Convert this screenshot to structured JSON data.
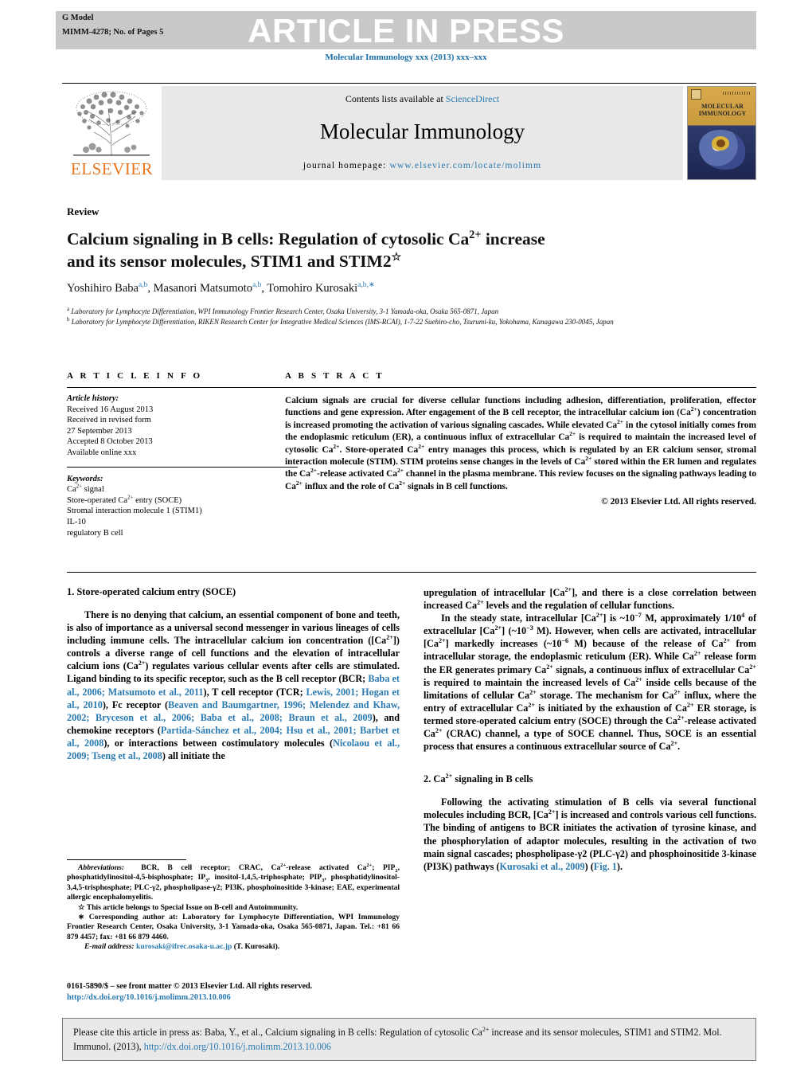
{
  "header": {
    "g_model": "G Model",
    "model_id": "MIMM-4278;   No. of Pages 5",
    "banner": "ARTICLE IN PRESS",
    "journal_ref": "Molecular Immunology xxx (2013) xxx–xxx"
  },
  "masthead": {
    "contents_prefix": "Contents lists available at ",
    "sciencedirect": "ScienceDirect",
    "journal_title": "Molecular Immunology",
    "homepage_label": "journal homepage: ",
    "homepage_url": "www.elsevier.com/locate/molimm",
    "publisher": "ELSEVIER",
    "cover_title_line1": "MOLECULAR",
    "cover_title_line2": "IMMUNOLOGY"
  },
  "article": {
    "type_label": "Review",
    "title_line1": "Calcium signaling in B cells: Regulation of cytosolic Ca",
    "title_sup1": "2+",
    "title_line1b": " increase",
    "title_line2": "and its sensor molecules, STIM1 and STIM2",
    "title_star": "☆",
    "authors_1": "Yoshihiro Baba",
    "authors_1_sup": "a,b",
    "authors_2": ", Masanori Matsumoto",
    "authors_2_sup": "a,b",
    "authors_3": ", Tomohiro Kurosaki",
    "authors_3_sup": "a,b,∗",
    "affil_a_sup": "a",
    "affil_a": " Laboratory for Lymphocyte Differentiation, WPI Immunology Frontier Research Center, Osaka University, 3-1 Yamada-oka, Osaka 565-0871, Japan",
    "affil_b_sup": "b",
    "affil_b": " Laboratory for Lymphocyte Differentiation, RIKEN Research Center for Integrative Medical Sciences (IMS-RCAI), 1-7-22 Suehiro-cho, Tsurumi-ku, Yokohama, Kanagawa 230-0045, Japan"
  },
  "info": {
    "heading": "A R T I C L E    I N F O",
    "history_label": "Article history:",
    "history": [
      "Received 16 August 2013",
      "Received in revised form",
      "27 September 2013",
      "Accepted 8 October 2013",
      "Available online xxx"
    ],
    "keywords_label": "Keywords:",
    "keywords": [
      "Ca2+ signal",
      "Store-operated Ca2+ entry (SOCE)",
      "Stromal interaction molecule 1 (STIM1)",
      "IL-10",
      "regulatory B cell"
    ]
  },
  "abstract": {
    "heading": "A B S T R A C T",
    "text": "Calcium signals are crucial for diverse cellular functions including adhesion, differentiation, proliferation, effector functions and gene expression. After engagement of the B cell receptor, the intracellular calcium ion (Ca2+) concentration is increased promoting the activation of various signaling cascades. While elevated Ca2+ in the cytosol initially comes from the endoplasmic reticulum (ER), a continuous influx of extracellular Ca2+ is required to maintain the increased level of cytosolic Ca2+. Store-operated Ca2+ entry manages this process, which is regulated by an ER calcium sensor, stromal interaction molecule (STIM). STIM proteins sense changes in the levels of Ca2+ stored within the ER lumen and regulates the Ca2+-release activated Ca2+ channel in the plasma membrane. This review focuses on the signaling pathways leading to Ca2+ influx and the role of Ca2+ signals in B cell functions.",
    "copyright": "© 2013 Elsevier Ltd. All rights reserved."
  },
  "body": {
    "section1_heading": "1.  Store-operated calcium entry (SOCE)",
    "section1_p1": "There is no denying that calcium, an essential component of bone and teeth, is also of importance as a universal second messenger in various lineages of cells including immune cells. The intracellular calcium ion concentration ([Ca2+]) controls a diverse range of cell functions and the elevation of intracellular calcium ions (Ca2+) regulates various cellular events after cells are stimulated. Ligand binding to its specific receptor, such as the B cell receptor (BCR; ",
    "cit1": "Baba et al., 2006; Matsumoto et al., 2011",
    "section1_p1b": "), T cell receptor (TCR; ",
    "cit2": "Lewis, 2001; Hogan et al., 2010",
    "section1_p1c": "), Fc receptor (",
    "cit3": "Beaven and Baumgartner, 1996; Melendez and Khaw, 2002; Bryceson et al., 2006; Baba et al., 2008; Braun et al., 2009",
    "section1_p1d": "), and chemokine receptors (",
    "cit4": "Partida-Sánchez et al., 2004; Hsu et al., 2001; Barbet et al., 2008",
    "section1_p1e": "), or interactions between costimulatory molecules (",
    "cit5": "Nicolaou et al., 2009; Tseng et al., 2008",
    "section1_p1f": ") all initiate the",
    "right_p1": "upregulation of intracellular [Ca2+], and there is a close correlation between increased Ca2+ levels and the regulation of cellular functions.",
    "right_p2": "In the steady state, intracellular [Ca2+] is ~10−7 M, approximately 1/104 of extracellular [Ca2+] (~10−3 M). However, when cells are activated, intracellular [Ca2+] markedly increases (~10−6 M) because of the release of Ca2+ from intracellular storage, the endoplasmic reticulum (ER). While Ca2+ release form the ER generates primary Ca2+ signals, a continuous influx of extracellular Ca2+ is required to maintain the increased levels of Ca2+ inside cells because of the limitations of cellular Ca2+ storage. The mechanism for Ca2+ influx, where the entry of extracellular Ca2+ is initiated by the exhaustion of Ca2+ ER storage, is termed store-operated calcium entry (SOCE) through the Ca2+-release activated Ca2+ (CRAC) channel, a type of SOCE channel. Thus, SOCE is an essential process that ensures a continuous extracellular source of Ca2+.",
    "section2_heading_a": "2.  Ca",
    "section2_heading_sup": "2+",
    "section2_heading_b": " signaling in B cells",
    "section2_p1": "Following the activating stimulation of B cells via several functional molecules including BCR, [Ca2+] is increased and controls various cell functions. The binding of antigens to BCR initiates the activation of tyrosine kinase, and the phosphorylation of adaptor molecules, resulting in the activation of two main signal cascades; phospholipase-γ2 (PLC-γ2) and phosphoinositide 3-kinase (PI3K) pathways (",
    "cit6": "Kurosaki et al., 2009",
    "section2_p1b": ") (",
    "cit7": "Fig. 1",
    "section2_p1c": ")."
  },
  "footnotes": {
    "abbrev_label": "Abbreviations:",
    "abbrev_text": "  BCR, B cell receptor; CRAC, Ca2+-release activated Ca2+; PIP2, phosphatidylinositol-4,5-bisphosphate; IP3, inositol-1,4,5,-triphosphate; PIP3, phosphatidylinositol-3,4,5-trisphosphate; PLC-γ2, phospholipase-γ2; PI3K, phosphoinositide 3-kinase; EAE, experimental allergic encephalomyelitis.",
    "star_note": "☆ This article belongs to Special Issue on B-cell and Autoimmunity.",
    "corresponding": "∗ Corresponding author at: Laboratory for Lymphocyte Differentiation, WPI Immunology Frontier Research Center, Osaka University, 3-1 Yamada-oka, Osaka 565-0871, Japan. Tel.: +81 66 879 4457; fax: +81 66 879 4460.",
    "email_label": "E-mail address:",
    "email": "kurosaki@ifrec.osaka-u.ac.jp",
    "email_suffix": " (T. Kurosaki).",
    "issn_line": "0161-5890/$ – see front matter © 2013 Elsevier Ltd. All rights reserved.",
    "issn_doi": "http://dx.doi.org/10.1016/j.molimm.2013.10.006"
  },
  "citation_box": {
    "text_a": "Please cite this article in press as: Baba, Y., et al., Calcium signaling in B cells: Regulation of cytosolic Ca",
    "text_sup": "2+",
    "text_b": " increase and its sensor molecules, STIM1 and STIM2. Mol. Immunol. (2013), ",
    "doi": "http://dx.doi.org/10.1016/j.molimm.2013.10.006"
  },
  "colors": {
    "link": "#2a7ab0",
    "banner_bg": "#c9c9c9",
    "elsevier_orange": "#e87722"
  }
}
